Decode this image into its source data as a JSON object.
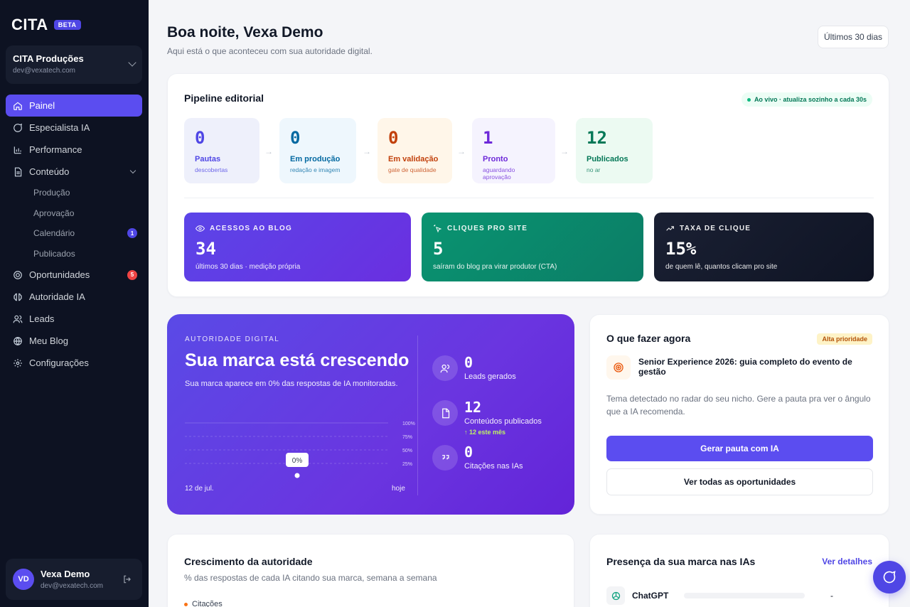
{
  "sidebar": {
    "logo": "CITA",
    "beta": "BETA",
    "org": {
      "name": "CITA Produções",
      "email": "dev@vexatech.com"
    },
    "nav": [
      {
        "label": "Painel",
        "icon": "home-icon"
      },
      {
        "label": "Especialista IA",
        "icon": "chat-icon"
      },
      {
        "label": "Performance",
        "icon": "bar-chart-icon"
      },
      {
        "label": "Conteúdo",
        "icon": "document-icon"
      },
      {
        "label": "Oportunidades",
        "icon": "target-icon",
        "count": "5"
      },
      {
        "label": "Autoridade IA",
        "icon": "brain-icon"
      },
      {
        "label": "Leads",
        "icon": "users-icon"
      },
      {
        "label": "Meu Blog",
        "icon": "globe-icon"
      },
      {
        "label": "Configurações",
        "icon": "gear-icon"
      }
    ],
    "content_sub": [
      {
        "label": "Produção"
      },
      {
        "label": "Aprovação"
      },
      {
        "label": "Calendário",
        "count": "1"
      },
      {
        "label": "Publicados"
      }
    ],
    "user": {
      "initials": "VD",
      "name": "Vexa Demo",
      "email": "dev@vexatech.com"
    }
  },
  "header": {
    "greeting": "Boa noite, Vexa Demo",
    "subtitle": "Aqui está o que aconteceu com sua autoridade digital.",
    "range": "Últimos 30 dias"
  },
  "pipeline": {
    "title": "Pipeline editorial",
    "live": "Ao vivo · atualiza sozinho a cada 30s",
    "stages": [
      {
        "value": "0",
        "label": "Pautas",
        "sub": "descobertas",
        "color": "#4f46e5",
        "bg": "#eef0fb"
      },
      {
        "value": "0",
        "label": "Em produção",
        "sub": "redação e imagem",
        "color": "#0369a1",
        "bg": "#eef7fd"
      },
      {
        "value": "0",
        "label": "Em validação",
        "sub": "gate de qualidade",
        "color": "#c2410c",
        "bg": "#fff6e9"
      },
      {
        "value": "1",
        "label": "Pronto",
        "sub": "aguardando aprovação",
        "color": "#6d28d9",
        "bg": "#f5f3fe"
      },
      {
        "value": "12",
        "label": "Publicados",
        "sub": "no ar",
        "color": "#047857",
        "bg": "#ecfaf2"
      }
    ],
    "kpis": [
      {
        "label": "ACESSOS AO BLOG",
        "value": "34",
        "sub": "últimos 30 dias · medição própria",
        "icon": "eye-icon"
      },
      {
        "label": "CLIQUES PRO SITE",
        "value": "5",
        "sub": "saíram do blog pra virar produtor (CTA)",
        "icon": "click-icon"
      },
      {
        "label": "TAXA DE CLIQUE",
        "value": "15%",
        "sub": "de quem lê, quantos clicam pro site",
        "icon": "trend-icon"
      }
    ]
  },
  "authority": {
    "eyebrow": "AUTORIDADE DIGITAL",
    "title": "Sua marca está crescendo",
    "subtitle": "Sua marca aparece em 0% das respostas de IA monitoradas.",
    "chart_data": {
      "type": "line",
      "y_ticks": [
        "100%",
        "75%",
        "50%",
        "25%"
      ],
      "ylim": [
        0,
        100
      ],
      "x_start": "12 de jul.",
      "x_end": "hoje",
      "current_label": "0%",
      "current_value": 0,
      "grid": true
    },
    "stats": [
      {
        "value": "0",
        "label": "Leads gerados",
        "icon": "users-icon"
      },
      {
        "value": "12",
        "label": "Conteúdos publicados",
        "trend": "↑ 12 este mês",
        "icon": "file-icon"
      },
      {
        "value": "0",
        "label": "Citações nas IAs",
        "icon": "quote-icon"
      }
    ]
  },
  "action": {
    "title": "O que fazer agora",
    "priority": "Alta prioridade",
    "topic": "Senior Experience 2026: guia completo do evento de gestão",
    "description": "Tema detectado no radar do seu nicho. Gere a pauta pra ver o ângulo que a IA recomenda.",
    "primary": "Gerar pauta com IA",
    "secondary": "Ver todas as oportunidades"
  },
  "growth": {
    "title": "Crescimento da autoridade",
    "subtitle": "% das respostas de cada IA citando sua marca, semana a semana",
    "legend": "Citações"
  },
  "presence": {
    "title": "Presença da sua marca nas IAs",
    "link": "Ver detalhes",
    "rows": [
      {
        "name": "ChatGPT",
        "value": "-"
      }
    ]
  }
}
